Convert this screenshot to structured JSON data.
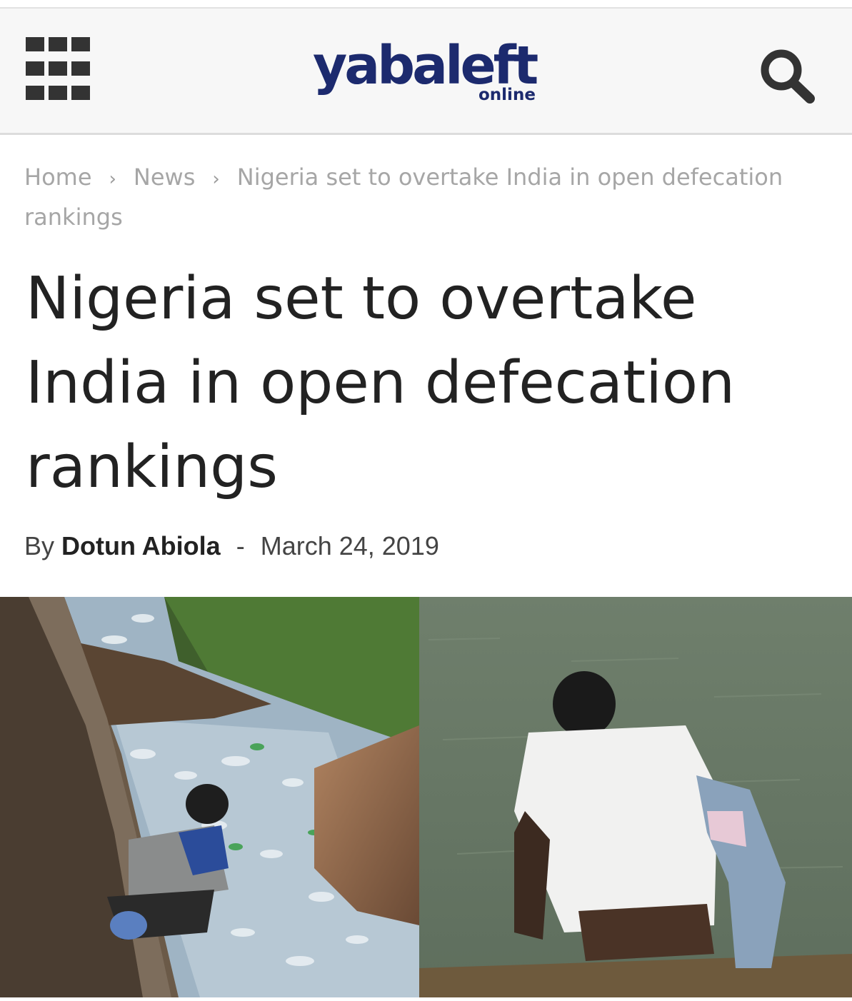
{
  "header": {
    "logo_main": "yabaleft",
    "logo_sub": "online",
    "menu_icon": "grid-menu-icon",
    "search_icon": "search-icon",
    "colors": {
      "logo": "#1c2a6e",
      "icons": "#333333",
      "header_bg": "#f7f7f7"
    }
  },
  "breadcrumb": {
    "items": [
      {
        "label": "Home"
      },
      {
        "label": "News"
      },
      {
        "label": "Nigeria set to overtake India in open defecation rankings"
      }
    ],
    "separator": "›"
  },
  "article": {
    "title": "Nigeria set to overtake India in open defecation rankings",
    "byline_prefix": "By",
    "author": "Dotun Abiola",
    "dash": "-",
    "date": "March 24, 2019"
  }
}
